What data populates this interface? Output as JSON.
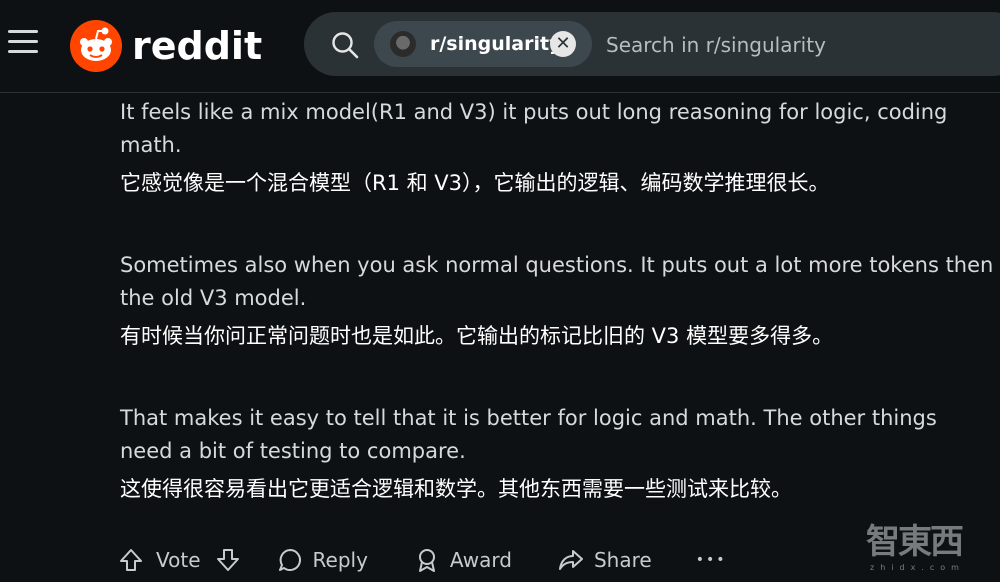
{
  "header": {
    "logo_text": "reddit",
    "search": {
      "chip_label": "r/singularity",
      "placeholder": "Search in r/singularity"
    }
  },
  "comment": {
    "paragraphs": [
      {
        "en": "It feels like a mix model(R1 and V3) it puts out long reasoning for logic, coding math.",
        "zh": "它感觉像是一个混合模型（R1 和 V3），它输出的逻辑、编码数学推理很长。"
      },
      {
        "en": "Sometimes also when you ask normal questions. It puts out a lot more tokens then the old V3 model.",
        "zh": "有时候当你问正常问题时也是如此。它输出的标记比旧的 V3 模型要多得多。"
      },
      {
        "en": "That makes it easy to tell that it is better for logic and math. The other things need a bit of testing to compare.",
        "zh": "这使得很容易看出它更适合逻辑和数学。其他东西需要一些测试来比较。"
      }
    ]
  },
  "actions": {
    "vote": "Vote",
    "reply": "Reply",
    "award": "Award",
    "share": "Share",
    "more": "•••"
  },
  "watermark": {
    "cn": "智東西",
    "en": "zhidx.com"
  },
  "colors": {
    "background": "#0e1113",
    "search_bg": "#2a3236",
    "chip_bg": "#3d484e",
    "brand": "#ff4500"
  }
}
